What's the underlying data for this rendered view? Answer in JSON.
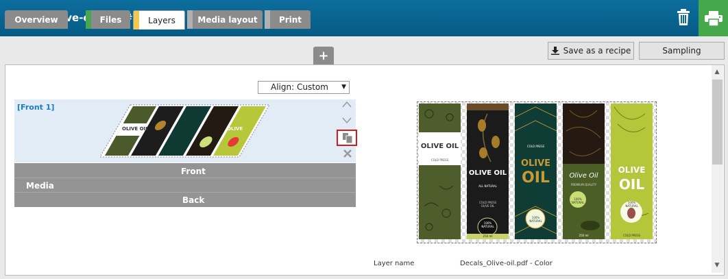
{
  "header": {
    "title": "Decals_Olive-oil.pdf #70"
  },
  "tabs": [
    {
      "label": "Overview"
    },
    {
      "label": "Files"
    },
    {
      "label": "Layers"
    },
    {
      "label": "Media layout"
    },
    {
      "label": "Print"
    }
  ],
  "tab_add": "+",
  "actions": {
    "save_recipe": "Save as a recipe",
    "sampling": "Sampling"
  },
  "align": {
    "value": "Align: Custom"
  },
  "front": {
    "label": "[Front 1]"
  },
  "media": {
    "label": "Media",
    "front": "Front",
    "back": "Back"
  },
  "layer": {
    "name_label": "Layer name",
    "name_value": "Decals_Olive-oil.pdf - Color"
  },
  "thumbnail": {
    "labels": [
      "OLIVE OIL",
      "",
      "",
      "OLIVE",
      "OLIVE OIL"
    ]
  },
  "preview_labels": [
    {
      "title": "OLIVE OIL",
      "sub": "COLD PRESS"
    },
    {
      "title": "OLIVE OIL",
      "sub": "ALL NATURAL",
      "extra": "COLD PRESS OLIVE OIL",
      "badge": "100% NATURAL",
      "vol": "250 ml"
    },
    {
      "pre": "COLD PRESS",
      "title1": "OLIVE",
      "title2": "OIL",
      "badge": "100% NATURAL"
    },
    {
      "title": "Olive Oil",
      "sub": "PREMIUM QUALITY",
      "badge": "100% NATURAL",
      "vol": "250 ml"
    },
    {
      "title1": "OLIVE",
      "title2": "OIL",
      "badge": "100% NATURAL",
      "sub": "COLD PRESS"
    }
  ],
  "colors": {
    "header": "#0d6e9e",
    "print": "#45a84b",
    "files_strip": "#45a84b",
    "layers_strip": "#f2c94c",
    "highlight": "#d21c1c",
    "link": "#1b7ec2"
  }
}
